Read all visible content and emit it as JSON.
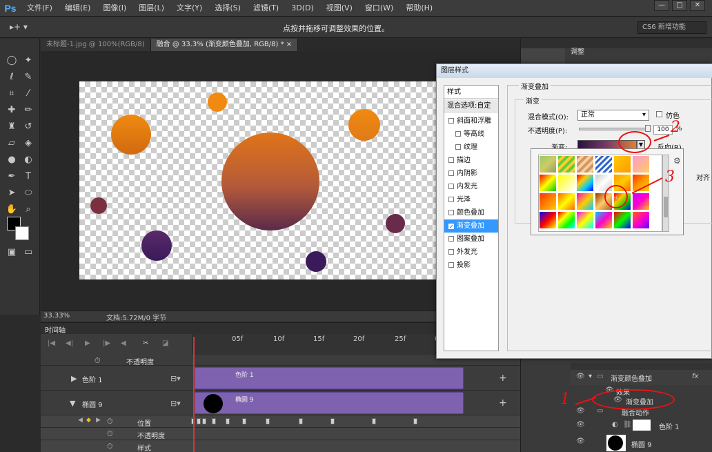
{
  "menubar": {
    "logo": "Ps",
    "items": [
      "文件(F)",
      "编辑(E)",
      "图像(I)",
      "图层(L)",
      "文字(Y)",
      "选择(S)",
      "滤镜(T)",
      "3D(D)",
      "视图(V)",
      "窗口(W)",
      "帮助(H)"
    ],
    "win_min": "—",
    "win_max": "□",
    "win_close": "✕"
  },
  "options": {
    "tool_label": "▸+ ▾",
    "hint": "点按并拖移可调整效果的位置。",
    "workspace": "CS6 新增功能"
  },
  "tabs": [
    {
      "label": "未标题-1.jpg @ 100%(RGB/8)",
      "active": false
    },
    {
      "label": "融合 @ 33.3% (渐变颜色叠加, RGB/8) * ×",
      "active": true
    }
  ],
  "status": {
    "zoom": "33.33%",
    "doc_size": "文档:5.72M/0 字节"
  },
  "timeline": {
    "title": "时间轴",
    "ticks": [
      "05f",
      "10f",
      "15f",
      "20f",
      "25f",
      "0"
    ],
    "rows": {
      "opacity_label": "不透明度",
      "levels_label": "色阶 1",
      "ellipse_label": "椭圆 9",
      "levels_track": "色阶 1",
      "ellipse_track": "椭圆 9",
      "position_label": "位置",
      "opacity2_label": "不透明度",
      "style_label": "样式"
    }
  },
  "right": {
    "adjust_tab": "调整",
    "action_tab": "动",
    "layers": {
      "group_name": "渐变颜色叠加",
      "effects_label": "效果",
      "gradient_overlay": "渐变叠加",
      "blend_group": "融合动作",
      "levels_layer": "色阶 1",
      "ellipse_layer": "椭圆 9"
    }
  },
  "dialog": {
    "title": "图层样式",
    "styles_header": "样式",
    "blend_options": "混合选项:自定",
    "styles": [
      {
        "label": "斜面和浮雕",
        "checked": false
      },
      {
        "label": "等高线",
        "checked": false
      },
      {
        "label": "纹理",
        "checked": false
      },
      {
        "label": "描边",
        "checked": false
      },
      {
        "label": "内阴影",
        "checked": false
      },
      {
        "label": "内发光",
        "checked": false
      },
      {
        "label": "光泽",
        "checked": false
      },
      {
        "label": "颜色叠加",
        "checked": false
      },
      {
        "label": "渐变叠加",
        "checked": true
      },
      {
        "label": "图案叠加",
        "checked": false
      },
      {
        "label": "外发光",
        "checked": false
      },
      {
        "label": "投影",
        "checked": false
      }
    ],
    "group_title": "渐变叠加",
    "sub_title": "渐变",
    "blend_mode_label": "混合模式(O):",
    "blend_mode_value": "正常",
    "dither_label": "仿色",
    "opacity_label": "不透明度(P):",
    "opacity_value": "100",
    "opacity_pct": "%",
    "gradient_label": "渐变:",
    "reverse_label": "反向(R)",
    "align_label": "对齐",
    "picker_gear": "⚙"
  },
  "annotations": [
    "1",
    "2",
    "3"
  ],
  "colors": {
    "accent": "#3399ff",
    "track": "#7e62b0",
    "annotation": "#e11111"
  }
}
